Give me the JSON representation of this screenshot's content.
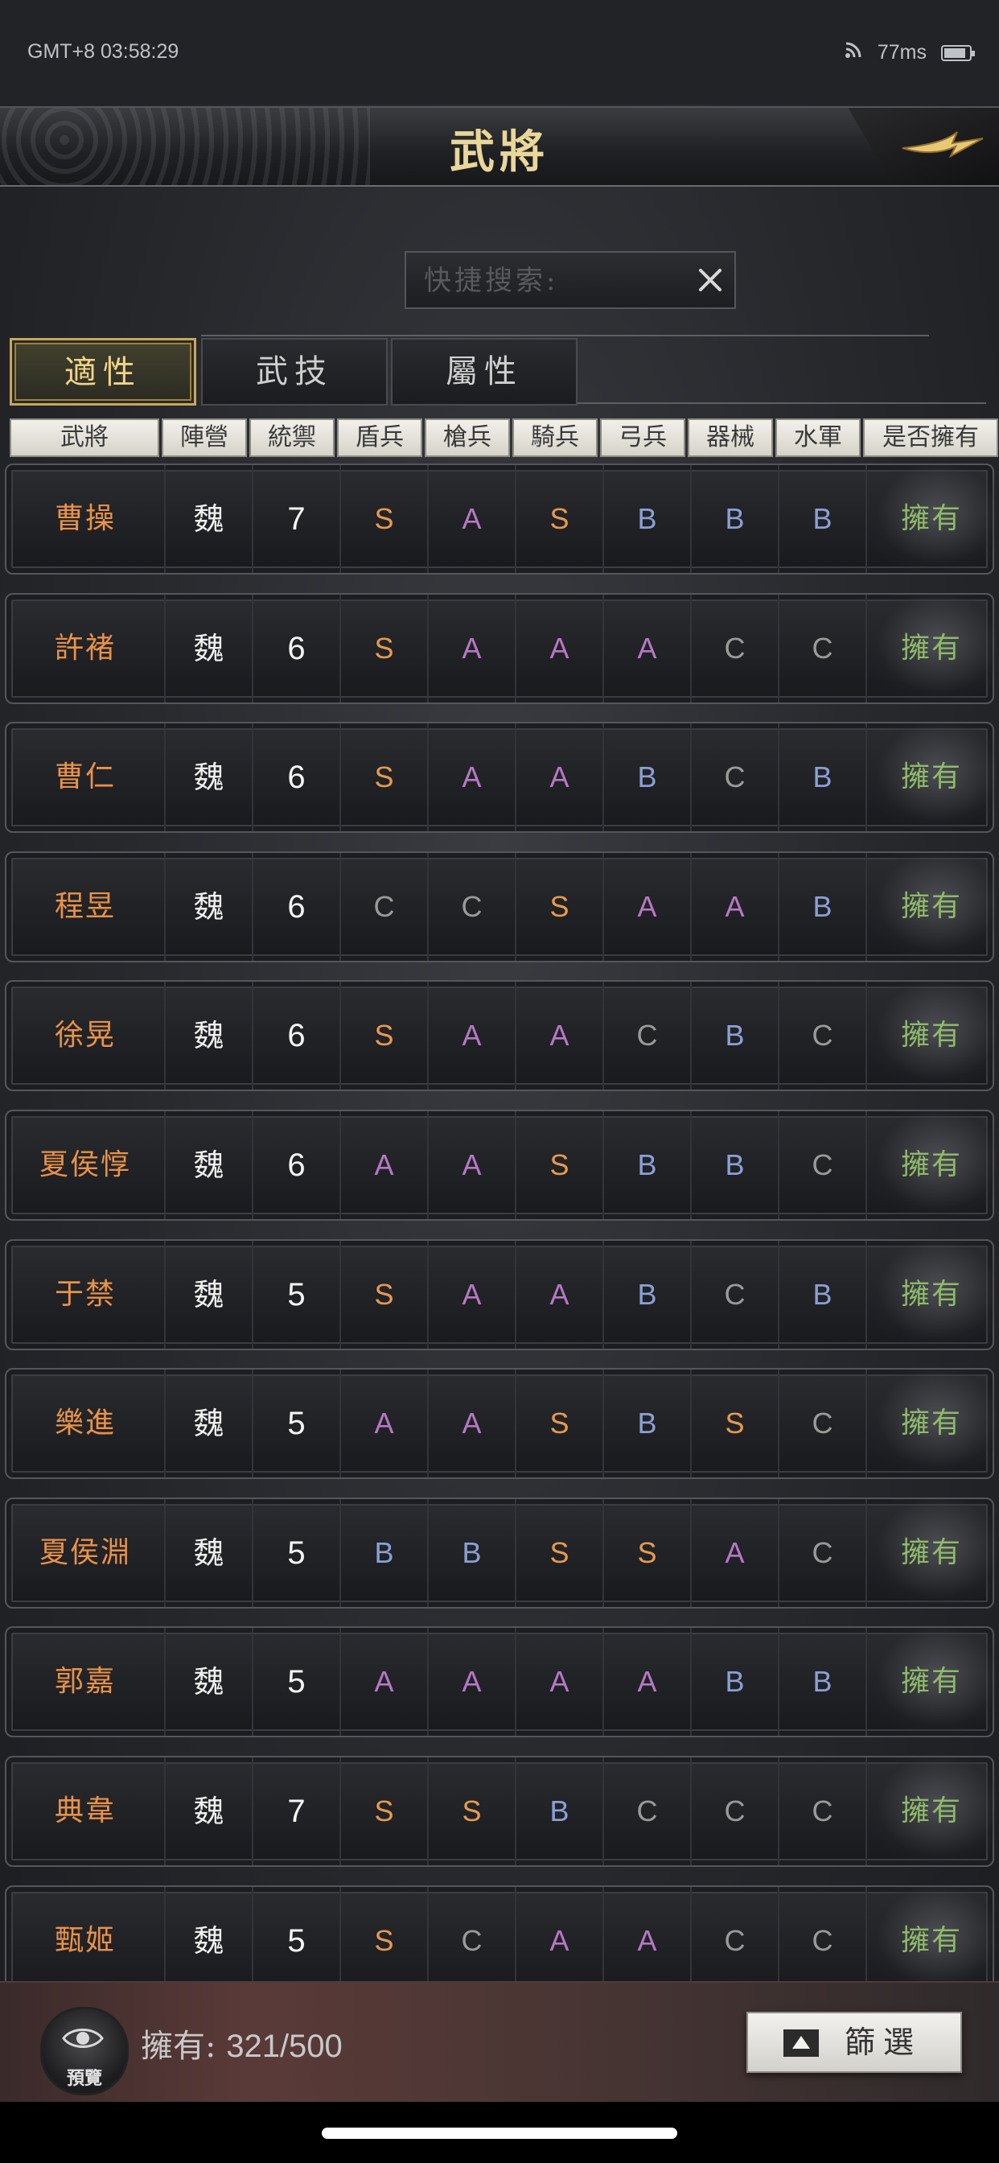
{
  "status": {
    "time": "GMT+8 03:58:29",
    "ping": "77ms"
  },
  "header": {
    "title": "武將",
    "back_icon": "arrow-right-icon"
  },
  "search": {
    "placeholder": "快捷搜索:",
    "value": ""
  },
  "tabs": [
    {
      "label": "適性",
      "active": true
    },
    {
      "label": "武技",
      "active": false
    },
    {
      "label": "屬性",
      "active": false
    }
  ],
  "columns": [
    "武將",
    "陣營",
    "統禦",
    "盾兵",
    "槍兵",
    "騎兵",
    "弓兵",
    "器械",
    "水軍",
    "是否擁有"
  ],
  "grade_colors": {
    "S": "#e69a4f",
    "A": "#b678c4",
    "B": "#8aa0d6",
    "C": "#9a9a9a"
  },
  "rows": [
    {
      "name": "曹操",
      "faction": "魏",
      "leadership": "7",
      "grades": [
        "S",
        "A",
        "S",
        "B",
        "B",
        "B"
      ],
      "owned": "擁有"
    },
    {
      "name": "許褚",
      "faction": "魏",
      "leadership": "6",
      "grades": [
        "S",
        "A",
        "A",
        "A",
        "C",
        "C"
      ],
      "owned": "擁有"
    },
    {
      "name": "曹仁",
      "faction": "魏",
      "leadership": "6",
      "grades": [
        "S",
        "A",
        "A",
        "B",
        "C",
        "B"
      ],
      "owned": "擁有"
    },
    {
      "name": "程昱",
      "faction": "魏",
      "leadership": "6",
      "grades": [
        "C",
        "C",
        "S",
        "A",
        "A",
        "B"
      ],
      "owned": "擁有"
    },
    {
      "name": "徐晃",
      "faction": "魏",
      "leadership": "6",
      "grades": [
        "S",
        "A",
        "A",
        "C",
        "B",
        "C"
      ],
      "owned": "擁有"
    },
    {
      "name": "夏侯惇",
      "faction": "魏",
      "leadership": "6",
      "grades": [
        "A",
        "A",
        "S",
        "B",
        "B",
        "C"
      ],
      "owned": "擁有"
    },
    {
      "name": "于禁",
      "faction": "魏",
      "leadership": "5",
      "grades": [
        "S",
        "A",
        "A",
        "B",
        "C",
        "B"
      ],
      "owned": "擁有"
    },
    {
      "name": "樂進",
      "faction": "魏",
      "leadership": "5",
      "grades": [
        "A",
        "A",
        "S",
        "B",
        "S",
        "C"
      ],
      "owned": "擁有"
    },
    {
      "name": "夏侯淵",
      "faction": "魏",
      "leadership": "5",
      "grades": [
        "B",
        "B",
        "S",
        "S",
        "A",
        "C"
      ],
      "owned": "擁有"
    },
    {
      "name": "郭嘉",
      "faction": "魏",
      "leadership": "5",
      "grades": [
        "A",
        "A",
        "A",
        "A",
        "B",
        "B"
      ],
      "owned": "擁有"
    },
    {
      "name": "典韋",
      "faction": "魏",
      "leadership": "7",
      "grades": [
        "S",
        "S",
        "B",
        "C",
        "C",
        "C"
      ],
      "owned": "擁有"
    },
    {
      "name": "甄姬",
      "faction": "魏",
      "leadership": "5",
      "grades": [
        "S",
        "C",
        "A",
        "A",
        "C",
        "C"
      ],
      "owned": "擁有"
    }
  ],
  "footer": {
    "preview_label": "預覽",
    "owned_label": "擁有:",
    "owned_count": "321/500",
    "filter_label": "篩選"
  }
}
